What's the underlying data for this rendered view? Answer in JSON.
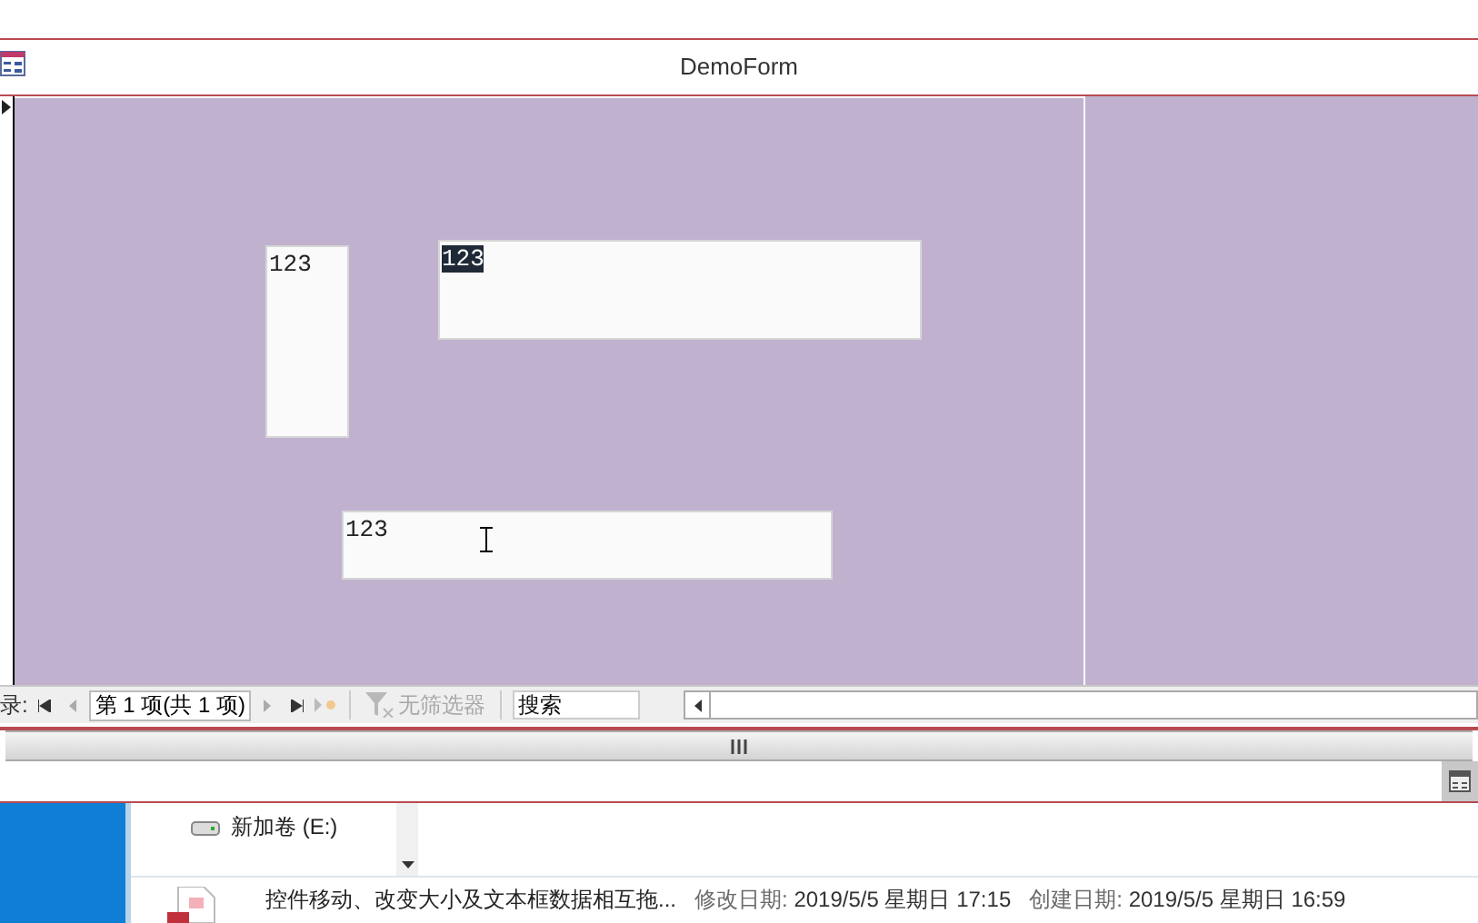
{
  "window": {
    "title": "DemoForm"
  },
  "form": {
    "textboxes": [
      {
        "value": "123",
        "selected": false,
        "cursor": false
      },
      {
        "value": "123",
        "selected": true,
        "cursor": false
      },
      {
        "value": "123",
        "selected": false,
        "cursor": true
      }
    ]
  },
  "navigation": {
    "label": "录:",
    "record": "第 1 项(共 1 项)",
    "filter": "无筛选器",
    "filter_disabled": true,
    "search_placeholder": "搜索"
  },
  "explorer": {
    "drive": "新加卷 (E:)",
    "file": {
      "name": "控件移动、改变大小及文本框数据相互拖...",
      "modified_label": "修改日期:",
      "modified": "2019/5/5 星期日 17:15",
      "created_label": "创建日期:",
      "created": "2019/5/5 星期日 16:59"
    }
  }
}
